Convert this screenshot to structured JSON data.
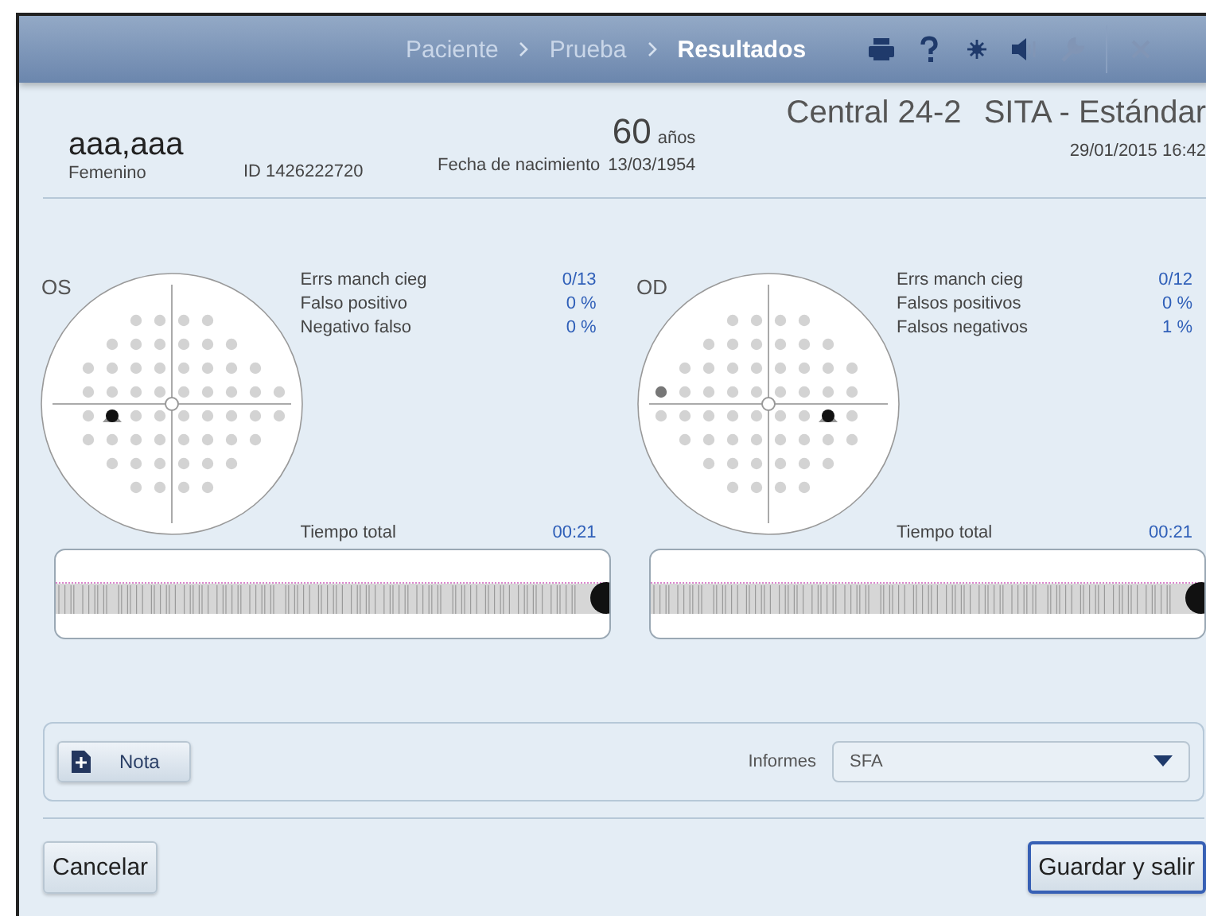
{
  "header": {
    "breadcrumbs": [
      {
        "label": "Paciente",
        "selected": false
      },
      {
        "label": "Prueba",
        "selected": false
      },
      {
        "label": "Resultados",
        "selected": true
      }
    ],
    "tools": [
      {
        "kind": "print",
        "disabled": false
      },
      {
        "kind": "help",
        "disabled": false
      },
      {
        "kind": "brightness",
        "disabled": false
      },
      {
        "kind": "volume",
        "disabled": false
      },
      {
        "kind": "settings",
        "disabled": true
      },
      {
        "kind": "close",
        "disabled": true
      }
    ]
  },
  "patient": {
    "name": "aaa,aaa",
    "sex": "Femenino",
    "id": "ID 1426222720",
    "birth_label": "Fecha de nacimiento",
    "birth_date": "13/03/1954",
    "age": "60",
    "age_unit": "años",
    "test": "Central 24-2",
    "strategy": "SITA - Estándar",
    "datetime": "29/01/2015 16:42"
  },
  "eyes": [
    {
      "label": "OS",
      "mirrored": false,
      "dark_point": false,
      "stats": [
        {
          "label": "Errs manch cieg",
          "value": "0/13"
        },
        {
          "label": "Falso positivo",
          "value": "0 %"
        },
        {
          "label": "Negativo falso",
          "value": "0 %"
        }
      ],
      "time_label": "Tiempo total",
      "time": "00:21"
    },
    {
      "label": "OD",
      "mirrored": true,
      "dark_point": true,
      "stats": [
        {
          "label": "Errs manch cieg",
          "value": "0/12"
        },
        {
          "label": "Falsos positivos",
          "value": "0 %"
        },
        {
          "label": "Falsos negativos",
          "value": "1 %"
        }
      ],
      "time_label": "Tiempo total",
      "time": "00:21"
    }
  ],
  "footer": {
    "note_button": "Nota",
    "reports_label": "Informes",
    "reports_value": "SFA",
    "cancel_button": "Cancelar",
    "save_button": "Guardar y salir"
  }
}
